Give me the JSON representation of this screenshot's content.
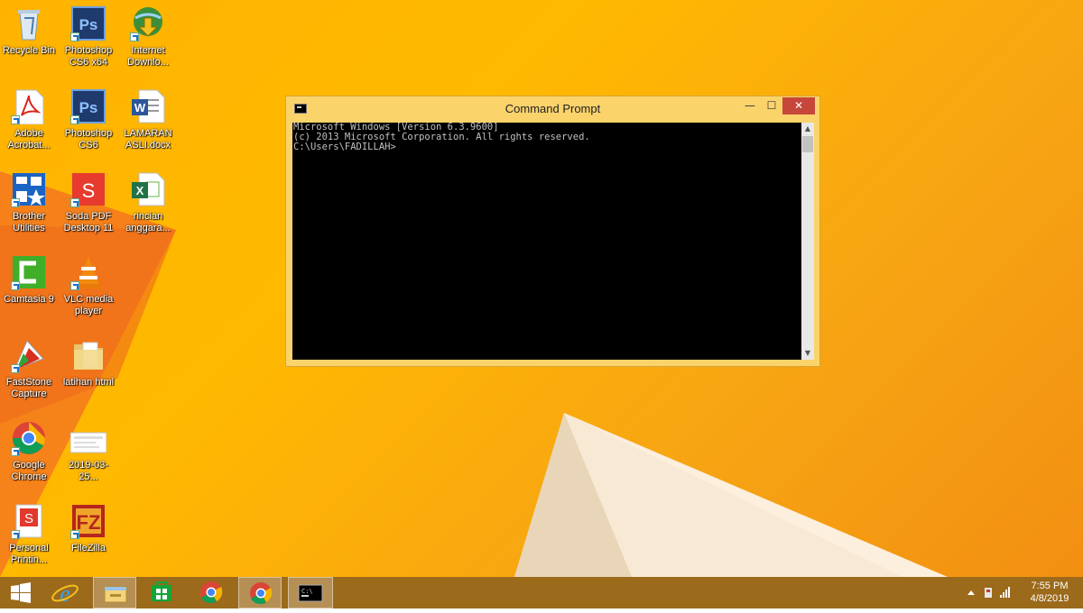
{
  "desktop": {
    "icons": [
      {
        "label": "Recycle Bin",
        "icon": "recycle-bin-icon"
      },
      {
        "label": "Photoshop CS6 x64",
        "icon": "photoshop-icon"
      },
      {
        "label": "Internet Downlo...",
        "icon": "idm-icon"
      },
      {
        "label": "Adobe Acrobat...",
        "icon": "acrobat-icon"
      },
      {
        "label": "Photoshop CS6",
        "icon": "photoshop-icon"
      },
      {
        "label": "LAMARAN ASLI.docx",
        "icon": "word-doc-icon"
      },
      {
        "label": "Brother Utilities",
        "icon": "brother-utilities-icon"
      },
      {
        "label": "Soda PDF Desktop 11",
        "icon": "soda-pdf-icon"
      },
      {
        "label": "rincian anggara...",
        "icon": "excel-doc-icon"
      },
      {
        "label": "Camtasia 9",
        "icon": "camtasia-icon"
      },
      {
        "label": "VLC media player",
        "icon": "vlc-icon"
      },
      {
        "label": "FastStone Capture",
        "icon": "faststone-icon"
      },
      {
        "label": "latihan html",
        "icon": "folder-icon"
      },
      {
        "label": "Google Chrome",
        "icon": "chrome-icon"
      },
      {
        "label": "2019-03-25...",
        "icon": "image-file-icon"
      },
      {
        "label": "Personal Printin...",
        "icon": "personal-printing-icon"
      },
      {
        "label": "FileZilla",
        "icon": "filezilla-icon"
      }
    ]
  },
  "window": {
    "title": "Command Prompt",
    "minimize": "—",
    "maximize": "☐",
    "close": "✕",
    "console_lines": [
      "Microsoft Windows [Version 6.3.9600]",
      "(c) 2013 Microsoft Corporation. All rights reserved.",
      "",
      "C:\\Users\\FADILLAH>"
    ],
    "scroll_up": "▲",
    "scroll_down": "▼"
  },
  "taskbar": {
    "items": [
      "start-icon",
      "internet-explorer-icon",
      "file-explorer-icon",
      "store-icon",
      "chrome-icon",
      "chrome-icon",
      "command-prompt-icon"
    ],
    "clock_time": "7:55 PM",
    "clock_date": "4/8/2019"
  },
  "colors": {
    "accent": "#ffb300",
    "taskbar": "#9c6a1b",
    "close": "#c7463a"
  }
}
